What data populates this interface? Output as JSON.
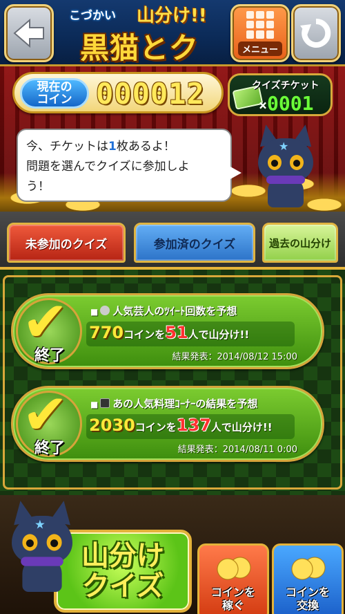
{
  "header": {
    "logo_small": "こづかい",
    "logo_top": "山分け!!",
    "logo_main": "黒猫とクイズ",
    "menu_label": "メニュー"
  },
  "coins": {
    "label_line1": "現在の",
    "label_line2": "コイン",
    "value": "000012"
  },
  "tickets": {
    "label": "クイズチケット",
    "prefix": "×",
    "count": "0001"
  },
  "bubble": {
    "text_a": "今、チケットは",
    "ticket_num": "1",
    "text_b": "枚あるよ！",
    "line2": "問題を選んでクイズに参加しよ",
    "line3": "う！"
  },
  "tabs": [
    {
      "label": "未参加のクイズ"
    },
    {
      "label": "参加済のクイズ"
    },
    {
      "label": "過去の山分け"
    }
  ],
  "quizzes": [
    {
      "status": "終了",
      "title": "人気芸人のﾂｲｰﾄ回数を予想",
      "coins": "770",
      "coins_suffix": "コインを",
      "people": "51",
      "people_suffix": "人で山分け!!",
      "result_label": "結果発表：",
      "result_date": "2014/08/12 15:00"
    },
    {
      "status": "終了",
      "title": "あの人気料理ｺｰﾅｰの結果を予想",
      "coins": "2030",
      "coins_suffix": "コインを",
      "people": "137",
      "people_suffix": "人で山分け!!",
      "result_label": "結果発表：",
      "result_date": "2014/08/11 0:00"
    }
  ],
  "footer": {
    "big_line1": "山分け",
    "big_line2": "クイズ",
    "earn_line1": "コインを",
    "earn_line2": "稼ぐ",
    "swap_line1": "コインを",
    "swap_line2": "交換"
  },
  "colors": {
    "accent_gold": "#d6a43a",
    "card_green": "#5cac1c",
    "tab_active": "#2c73c8"
  }
}
